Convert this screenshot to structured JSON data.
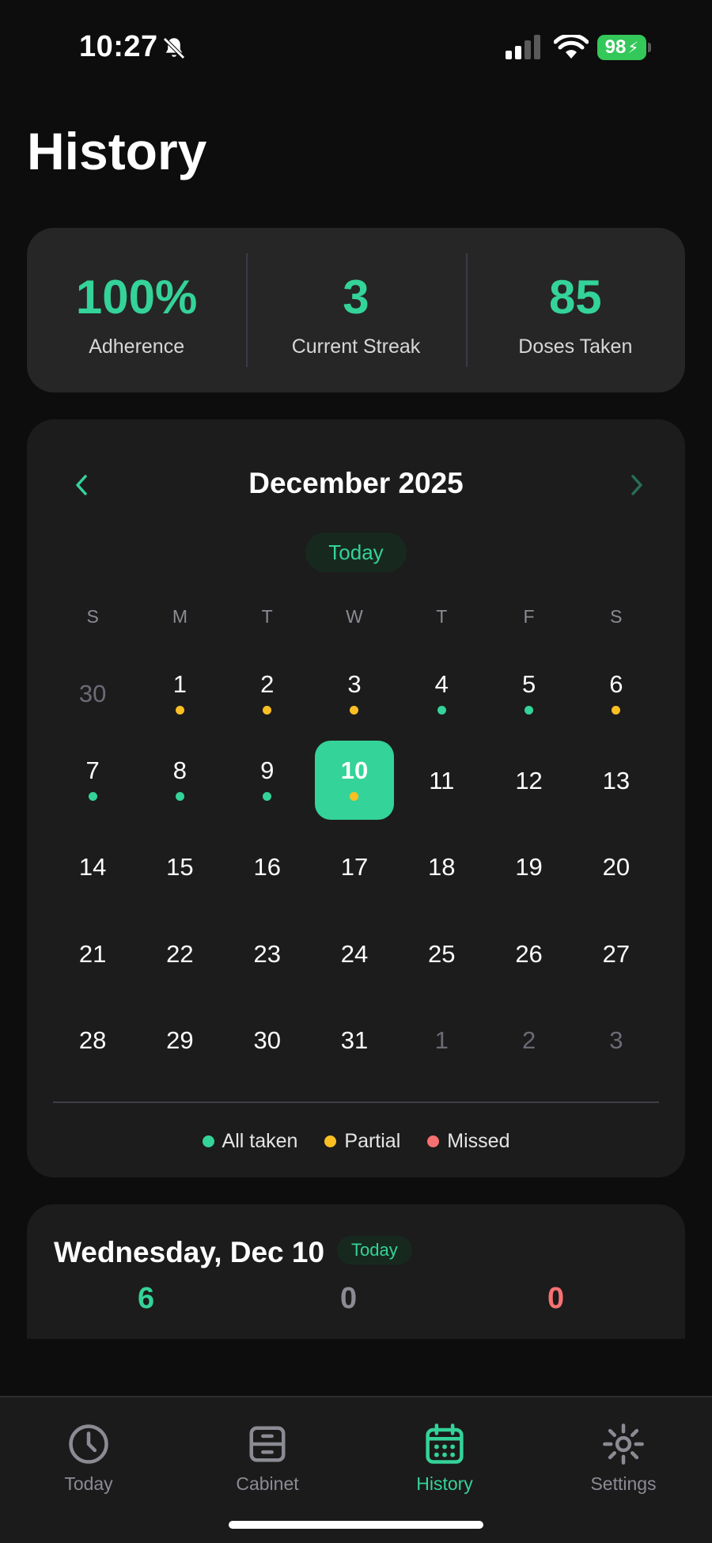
{
  "status_bar": {
    "time": "10:27",
    "battery": "98"
  },
  "page": {
    "title": "History"
  },
  "stats": [
    {
      "value": "100%",
      "label": "Adherence"
    },
    {
      "value": "3",
      "label": "Current Streak"
    },
    {
      "value": "85",
      "label": "Doses Taken"
    }
  ],
  "calendar": {
    "month_title": "December 2025",
    "today_button": "Today",
    "weekdays": [
      "S",
      "M",
      "T",
      "W",
      "T",
      "F",
      "S"
    ],
    "days": [
      {
        "n": "30",
        "muted": true
      },
      {
        "n": "1",
        "dot": "partial"
      },
      {
        "n": "2",
        "dot": "partial"
      },
      {
        "n": "3",
        "dot": "partial"
      },
      {
        "n": "4",
        "dot": "all"
      },
      {
        "n": "5",
        "dot": "all"
      },
      {
        "n": "6",
        "dot": "partial"
      },
      {
        "n": "7",
        "dot": "all"
      },
      {
        "n": "8",
        "dot": "all"
      },
      {
        "n": "9",
        "dot": "all"
      },
      {
        "n": "10",
        "dot": "partial",
        "today": true
      },
      {
        "n": "11"
      },
      {
        "n": "12"
      },
      {
        "n": "13"
      },
      {
        "n": "14"
      },
      {
        "n": "15"
      },
      {
        "n": "16"
      },
      {
        "n": "17"
      },
      {
        "n": "18"
      },
      {
        "n": "19"
      },
      {
        "n": "20"
      },
      {
        "n": "21"
      },
      {
        "n": "22"
      },
      {
        "n": "23"
      },
      {
        "n": "24"
      },
      {
        "n": "25"
      },
      {
        "n": "26"
      },
      {
        "n": "27"
      },
      {
        "n": "28"
      },
      {
        "n": "29"
      },
      {
        "n": "30"
      },
      {
        "n": "31"
      },
      {
        "n": "1",
        "muted": true
      },
      {
        "n": "2",
        "muted": true
      },
      {
        "n": "3",
        "muted": true
      }
    ],
    "legend": [
      {
        "label": "All taken",
        "color": "#34d399"
      },
      {
        "label": "Partial",
        "color": "#fbbf24"
      },
      {
        "label": "Missed",
        "color": "#f87171"
      }
    ],
    "dot_colors": {
      "all": "#34d399",
      "partial": "#fbbf24",
      "missed": "#f87171"
    }
  },
  "day_detail": {
    "title": "Wednesday, Dec 10",
    "badge": "Today",
    "counts": [
      "6",
      "0",
      "0"
    ]
  },
  "tabs": [
    {
      "label": "Today",
      "icon": "clock-icon"
    },
    {
      "label": "Cabinet",
      "icon": "cabinet-icon"
    },
    {
      "label": "History",
      "icon": "calendar-icon",
      "active": true
    },
    {
      "label": "Settings",
      "icon": "gear-icon"
    }
  ],
  "colors": {
    "accent": "#34d399",
    "partial": "#fbbf24",
    "missed": "#f87171"
  }
}
